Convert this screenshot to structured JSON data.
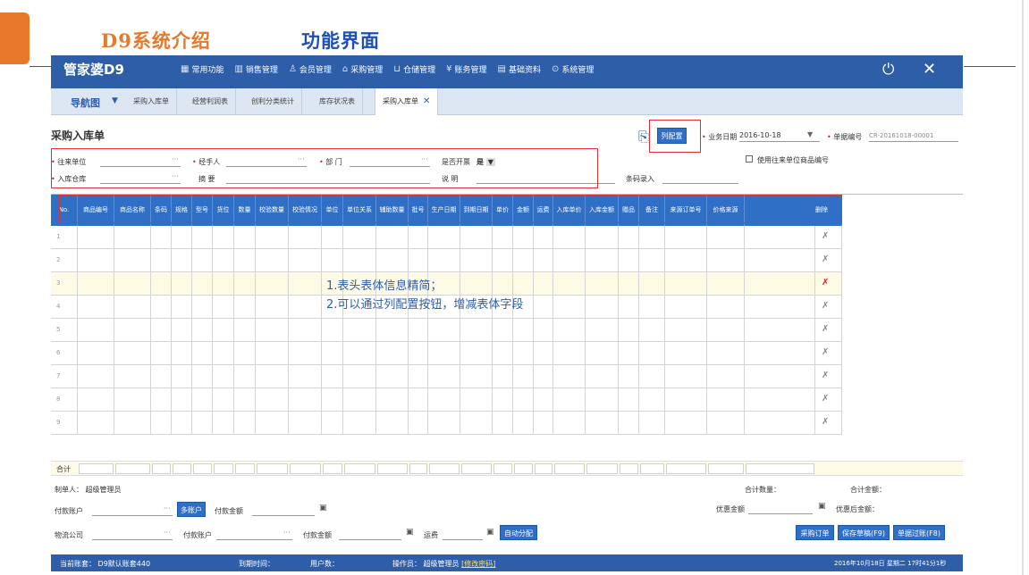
{
  "slide": {
    "title_left": "D9系统介绍",
    "title_right": "功能界面",
    "accent_color": "#e8782a",
    "title_color": "#1e4fb3"
  },
  "app": {
    "logo": "管家婆D9",
    "menu": [
      {
        "icon": "grid-icon",
        "glyph": "▦",
        "label": "常用功能"
      },
      {
        "icon": "chart-icon",
        "glyph": "▥",
        "label": "销售管理"
      },
      {
        "icon": "user-icon",
        "glyph": "♙",
        "label": "会员管理"
      },
      {
        "icon": "home-icon",
        "glyph": "⌂",
        "label": "采购管理"
      },
      {
        "icon": "cart-icon",
        "glyph": "⊔",
        "label": "仓储管理"
      },
      {
        "icon": "yen-icon",
        "glyph": "¥",
        "label": "账务管理"
      },
      {
        "icon": "doc-icon",
        "glyph": "▤",
        "label": "基础资料"
      },
      {
        "icon": "gear-icon",
        "glyph": "⊙",
        "label": "系统管理"
      }
    ],
    "power_glyph": "⏻",
    "close_glyph": "✕",
    "brand_color": "#2f5ea8"
  },
  "tabs": {
    "nav": "导航图",
    "nav_caret": "▼",
    "items": [
      "采购入库单",
      "经营利润表",
      "创利分类统计",
      "库存状况表"
    ],
    "active": "采购入库单",
    "active_close": "✕"
  },
  "form": {
    "title": "采购入库单",
    "col_config_button": "列配置",
    "biz_date_label": "业务日期",
    "biz_date_value": "2016-10-18",
    "doc_no_label": "单据编号",
    "doc_no_value": "CR-20161018-00001",
    "fields": {
      "supplier": "往来单位",
      "handler": "经手人",
      "dept": "部 门",
      "invoice": "是否开票",
      "invoice_value": "是",
      "warehouse": "入库仓库",
      "summary": "摘 要",
      "note": "说 明",
      "barcode": "条码录入",
      "use_supplier_code": "使用往来单位商品编号"
    }
  },
  "grid": {
    "columns": [
      "No.",
      "商品编号",
      "商品名称",
      "条码",
      "规格",
      "型号",
      "货位",
      "数量",
      "校验数量",
      "校验情况",
      "单位",
      "单位关系",
      "辅助数量",
      "批号",
      "生产日期",
      "到期日期",
      "单价",
      "金额",
      "运费",
      "入库单价",
      "入库金额",
      "赠品",
      "备注",
      "来源订单号",
      "价格来源",
      "删除"
    ],
    "rows": [
      "1",
      "2",
      "3",
      "4",
      "5",
      "6",
      "7",
      "8",
      "9"
    ],
    "delete_glyph": "✗",
    "total_label": "合计"
  },
  "annotation": {
    "line1": "1.表头表体信息精简；",
    "line2": "2.可以通过列配置按钮，增减表体字段"
  },
  "footer": {
    "maker_label": "制单人：",
    "maker_value": "超级管理员",
    "total_qty": "合计数量：",
    "total_amount": "合计金额：",
    "pay_account": "付款账户",
    "multi_account": "多账户",
    "pay_amount": "付款金额",
    "discount_amount": "优惠金额",
    "after_discount": "优惠后金额：",
    "logistics": "物流公司",
    "pay_account2": "付款账户",
    "pay_amount2": "付款金额",
    "freight": "运费",
    "auto_allocate": "自动分配",
    "btn_po": "采购订单",
    "btn_save_draft": "保存草稿(F9)",
    "btn_post": "单据过账(F8)"
  },
  "status": {
    "account": "当前账套： D9默认账套440",
    "expire": "到期时间：",
    "users": "用户数：",
    "operator": "操作员： 超级管理员",
    "change_pwd": "[修改密码]",
    "datetime": "2016年10月18日 星期二 17时41分1秒"
  }
}
